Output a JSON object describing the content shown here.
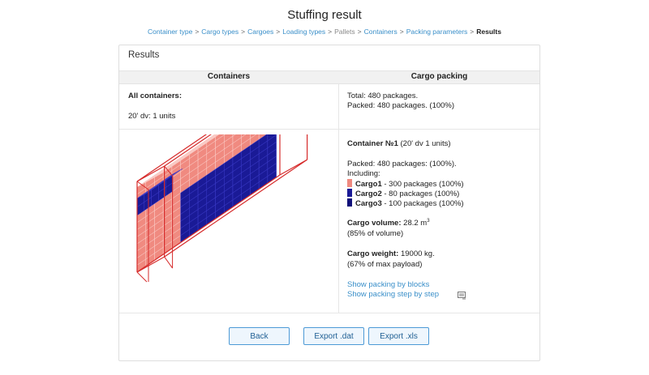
{
  "page": {
    "title": "Stuffing result"
  },
  "breadcrumb": [
    {
      "label": "Container type",
      "state": "link"
    },
    {
      "label": "Cargo types",
      "state": "link"
    },
    {
      "label": "Cargoes",
      "state": "link"
    },
    {
      "label": "Loading types",
      "state": "link"
    },
    {
      "label": "Pallets",
      "state": "disabled"
    },
    {
      "label": "Containers",
      "state": "link"
    },
    {
      "label": "Packing parameters",
      "state": "link"
    },
    {
      "label": "Results",
      "state": "current"
    }
  ],
  "breadcrumb_separator": ">",
  "card": {
    "title": "Results",
    "columns": {
      "left": "Containers",
      "right": "Cargo packing"
    },
    "summary": {
      "all_containers_label": "All containers:",
      "container_line": "20' dv: 1 units",
      "total": "Total: 480 packages.",
      "packed": "Packed: 480 packages. (100%)"
    },
    "container": {
      "title": "Container №1",
      "title_suffix": " (20' dv 1 units)",
      "packed": "Packed: 480 packages: (100%).",
      "including": "Including:",
      "cargo": [
        {
          "name": "Cargo1",
          "detail": " - 300 packages (100%)",
          "color": "#f08a80"
        },
        {
          "name": "Cargo2",
          "detail": " - 80 packages (100%)",
          "color": "#1a1a96"
        },
        {
          "name": "Cargo3",
          "detail": " - 100 packages (100%)",
          "color": "#10107a"
        }
      ],
      "volume_label": "Cargo volume:",
      "volume_value": " 28.2 m",
      "volume_unit_sup": "3",
      "volume_pct": "(85% of volume)",
      "weight_label": "Cargo weight:",
      "weight_value": " 19000 kg.",
      "weight_pct": "(67% of max payload)",
      "link_blocks": "Show packing by blocks",
      "link_steps": "Show packing step by step",
      "steps_icon": "list-icon"
    }
  },
  "buttons": {
    "back": "Back",
    "export_dat": "Export .dat",
    "export_xls": "Export .xls"
  },
  "colors": {
    "accent": "#3a8fc9",
    "container_outline": "#d62b2b",
    "cargo_pink": "#f08a80",
    "cargo_navy": "#1a1a96"
  }
}
